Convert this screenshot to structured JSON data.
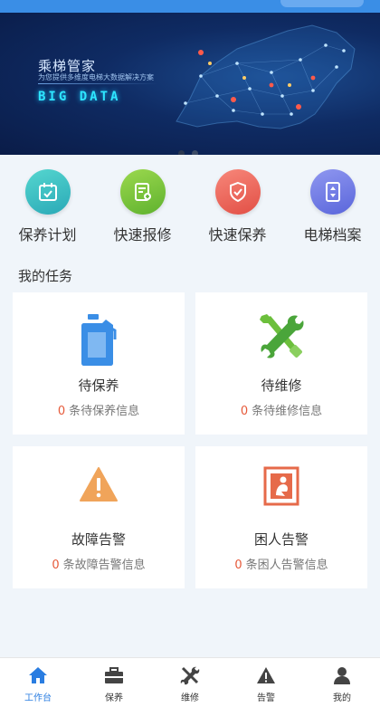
{
  "banner": {
    "title": "乘梯管家",
    "subtitle": "为您提供多维度电梯大数据解决方案",
    "big_data_text": "BIG DATA"
  },
  "quick_actions": [
    {
      "label": "保养计划",
      "icon": "calendar-check-icon",
      "color": "#3cc3c3"
    },
    {
      "label": "快速报修",
      "icon": "report-form-icon",
      "color": "#7cc63a"
    },
    {
      "label": "快速保养",
      "icon": "shield-check-icon",
      "color": "#ef6a5a"
    },
    {
      "label": "电梯档案",
      "icon": "elevator-icon",
      "color": "#6f7de8"
    }
  ],
  "tasks": {
    "section_title": "我的任务",
    "cards": [
      {
        "title": "待保养",
        "count": "0",
        "desc": "条待保养信息",
        "icon": "oil-bottle-icon",
        "color": "#3a8ee6"
      },
      {
        "title": "待维修",
        "count": "0",
        "desc": "条待维修信息",
        "icon": "wrench-screwdriver-icon",
        "color": "#6cbf3c"
      },
      {
        "title": "故障告警",
        "count": "0",
        "desc": "条故障告警信息",
        "icon": "warning-triangle-icon",
        "color": "#f0a45a"
      },
      {
        "title": "困人告警",
        "count": "0",
        "desc": "条困人告警信息",
        "icon": "trapped-person-icon",
        "color": "#e66a4a"
      }
    ]
  },
  "tabbar": {
    "active_color": "#2a7de1",
    "items": [
      {
        "label": "工作台",
        "icon": "home-icon"
      },
      {
        "label": "保养",
        "icon": "toolbox-icon"
      },
      {
        "label": "维修",
        "icon": "tools-icon"
      },
      {
        "label": "告警",
        "icon": "alert-icon"
      },
      {
        "label": "我的",
        "icon": "user-icon"
      }
    ]
  }
}
